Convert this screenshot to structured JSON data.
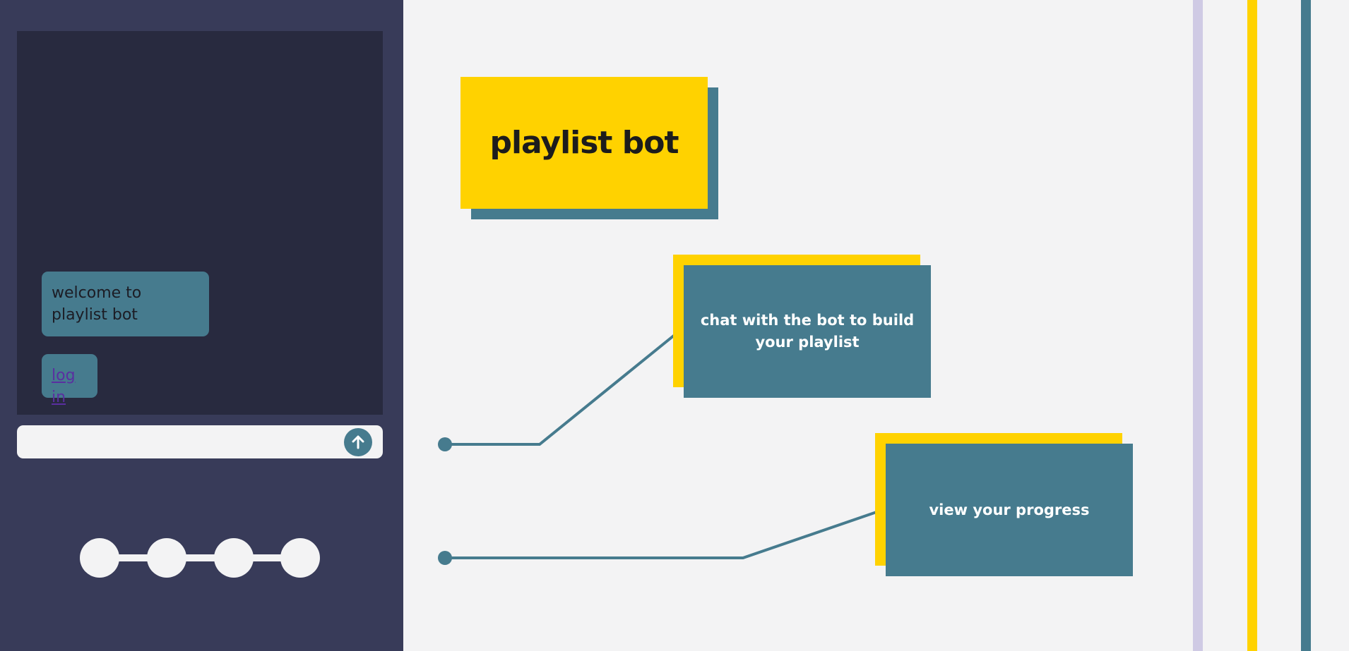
{
  "chat": {
    "messages": [
      {
        "text": "welcome to playlist bot"
      },
      {
        "link_text": "log in"
      }
    ],
    "input": {
      "value": "",
      "placeholder": ""
    },
    "send_icon": "arrow-up-icon"
  },
  "progress": {
    "steps": 4
  },
  "main": {
    "title": "playlist bot",
    "cards": [
      {
        "label": "chat with the bot to build your playlist"
      },
      {
        "label": "view your progress"
      }
    ]
  },
  "colors": {
    "sidebar": "#383b59",
    "chat_bg": "#282a3f",
    "accent_teal": "#467b8e",
    "accent_yellow": "#ffd200",
    "stripe_lavender": "#cfcae4",
    "page_bg": "#f3f3f4"
  }
}
